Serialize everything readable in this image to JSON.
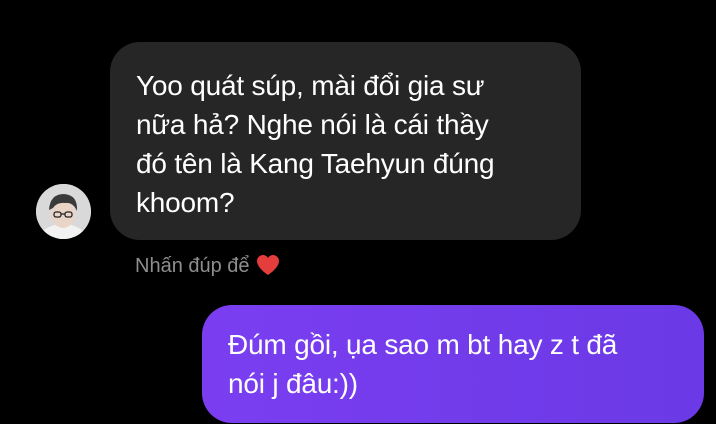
{
  "messages": [
    {
      "sender": "other",
      "lines": [
        "Yoo quát súp, mài đổi gia sư",
        "nữa hả? Nghe nói là cái thầy",
        "đó tên là Kang Taehyun đúng",
        "khoom?"
      ]
    },
    {
      "sender": "me",
      "lines": [
        "Đúm gồi, ụa sao m bt hay z t đã",
        "nói j đâu:))"
      ]
    }
  ],
  "hint": {
    "text": "Nhấn đúp để",
    "icon": "heart-icon"
  },
  "colors": {
    "background": "#000000",
    "incoming_bubble": "#262626",
    "outgoing_bubble": "#7a3ef0",
    "heart": "#e53c3c",
    "hint_text": "#8e8e8e"
  }
}
